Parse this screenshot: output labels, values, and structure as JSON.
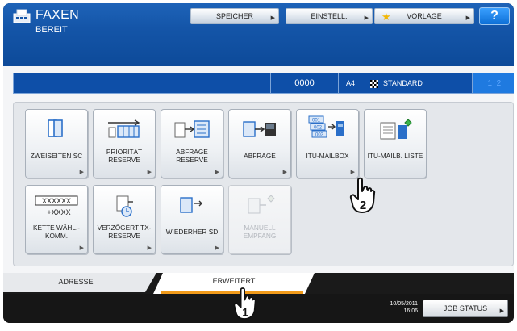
{
  "header": {
    "title": "FAXEN",
    "status": "BEREIT",
    "buttons": {
      "speicher": "SPEICHER",
      "einstell": "EINSTELL.",
      "vorlage": "VORLAGE",
      "help": "?"
    }
  },
  "status_bar": {
    "count": "0000",
    "paper": "A4",
    "mode": "STANDARD",
    "lines": " 1  2"
  },
  "tiles": [
    {
      "label": "ZWEISEITEN SC",
      "icon": "duplex-scan-icon"
    },
    {
      "label": "PRIORITÄT RESERVE",
      "icon": "priority-reserve-icon"
    },
    {
      "label": "ABFRAGE RESERVE",
      "icon": "polling-reserve-icon"
    },
    {
      "label": "ABFRAGE",
      "icon": "polling-icon"
    },
    {
      "label": "ITU-MAILBOX",
      "icon": "itu-mailbox-icon"
    },
    {
      "label": "ITU-MAILB. LISTE",
      "icon": "itu-mailbox-list-icon"
    },
    {
      "label": "KETTE WÄHL.-KOMM.",
      "icon": "chain-dial-icon",
      "chain_top": "XXXXXX",
      "chain_bottom": "+XXXX"
    },
    {
      "label": "VERZÖGERT TX-RESERVE",
      "icon": "delayed-tx-icon"
    },
    {
      "label": "WIEDERHER SD",
      "icon": "recover-sd-icon"
    },
    {
      "label": "MANUELL EMPFANG",
      "icon": "manual-receive-icon",
      "disabled": true
    }
  ],
  "tabs": {
    "adresse": "ADRESSE",
    "erweitert": "ERWEITERT"
  },
  "footer": {
    "date": "10/05/2011",
    "time": "16:06",
    "job_status": "JOB STATUS"
  },
  "annotations": {
    "step1": "1",
    "step2": "2"
  },
  "colors": {
    "header_blue": "#1455a8",
    "tab_accent": "#f09a1a"
  }
}
